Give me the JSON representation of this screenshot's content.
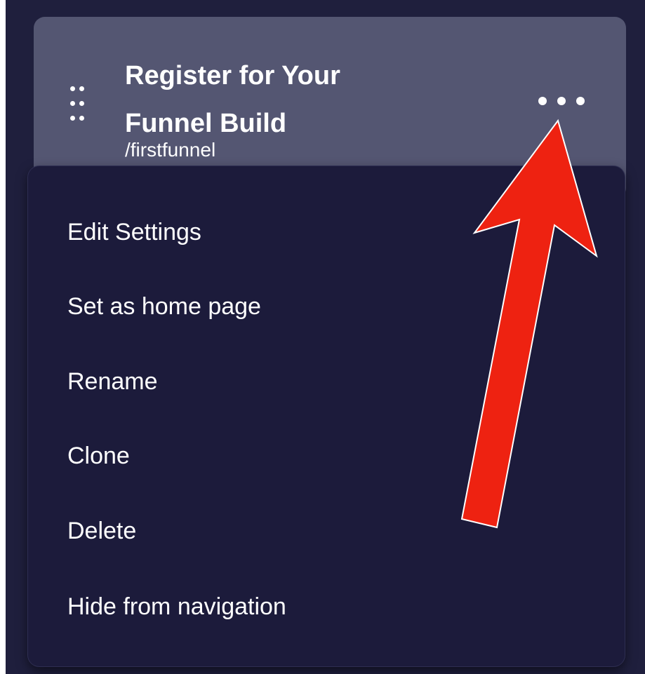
{
  "page_card": {
    "title_line1": "Register for Your",
    "title_line2": "Funnel Build",
    "slug": "/firstfunnel",
    "more_icon": "more-horizontal-icon",
    "drag_icon": "drag-handle-icon"
  },
  "menu": {
    "items": [
      {
        "label": "Edit Settings"
      },
      {
        "label": "Set as home page"
      },
      {
        "label": "Rename"
      },
      {
        "label": "Clone"
      },
      {
        "label": "Delete"
      },
      {
        "label": "Hide from navigation"
      }
    ]
  },
  "annotation": {
    "arrow_icon": "arrow-up-icon",
    "color": "#ee2211"
  },
  "colors": {
    "background": "#1f1f3d",
    "card": "#545672",
    "menu": "#1c1b3b",
    "text": "#ffffff"
  }
}
